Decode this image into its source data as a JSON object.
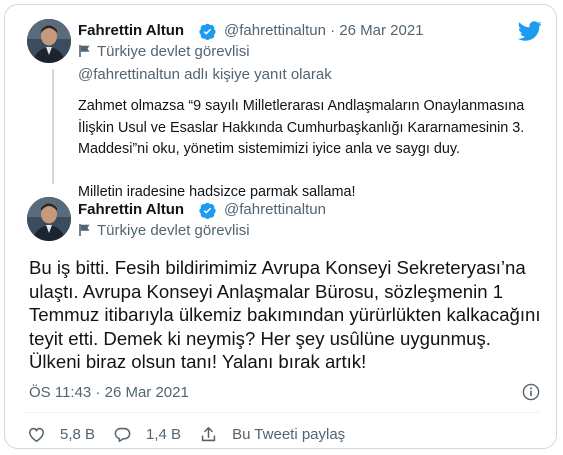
{
  "colors": {
    "twitter_blue": "#1d9bf0",
    "secondary_text": "#536471",
    "border": "#cfd9de"
  },
  "quoted_tweet": {
    "author_name": "Fahrettin Altun",
    "handle": "@fahrettinaltun",
    "separator": "·",
    "date": "26 Mar 2021",
    "label": "Türkiye devlet görevlisi",
    "reply_to": "@fahrettinaltun adlı kişiye yanıt olarak",
    "text_p1": "Zahmet olmazsa “9 sayılı Milletlerarası Andlaşmaların Onaylanmasına İlişkin Usul ve Esaslar Hakkında Cumhurbaşkanlığı Kararnamesinin 3. Maddesi”ni oku, yönetim sistemimizi iyice anla ve saygı duy.",
    "text_p2": "Milletin iradesine hadsizce parmak sallama!"
  },
  "main_tweet": {
    "author_name": "Fahrettin Altun",
    "handle": "@fahrettinaltun",
    "label": "Türkiye devlet görevlisi",
    "text": "Bu iş bitti. Fesih bildirimimiz Avrupa Konseyi Sekreteryası’na ulaştı. Avrupa Konseyi Anlaşmalar Bürosu, sözleşmenin 1 Temmuz itibarıyla ülkemiz bakımından yürürlükten kalkacağını teyit etti. Demek ki neymiş? Her şey usûlüne uygunmuş. Ülkeni biraz olsun tanı! Yalanı bırak artık!",
    "time": "ÖS 11:43",
    "separator": "·",
    "date": "26 Mar 2021",
    "likes": "5,8 B",
    "replies": "1,4 B",
    "share_label": "Bu Tweeti paylaş"
  },
  "icons": {
    "logo": "twitter-bird-icon",
    "verified": "verified-badge-icon",
    "label": "flag-icon",
    "info": "info-icon",
    "like": "heart-icon",
    "reply": "reply-icon",
    "share": "share-icon"
  }
}
